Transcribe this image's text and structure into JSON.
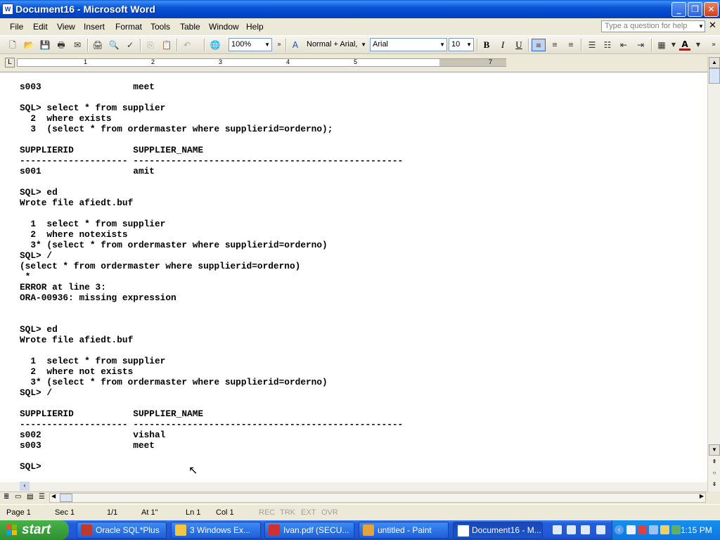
{
  "window": {
    "title": "Document16 - Microsoft Word",
    "app_icon": "W"
  },
  "menu": {
    "items": [
      "File",
      "Edit",
      "View",
      "Insert",
      "Format",
      "Tools",
      "Table",
      "Window",
      "Help"
    ],
    "help_placeholder": "Type a question for help"
  },
  "toolbar": {
    "zoom": "100%",
    "style": "Normal + Arial,",
    "font": "Arial",
    "size": "10",
    "bold": "B",
    "italic": "I",
    "underline": "U",
    "font_color_letter": "A"
  },
  "ruler": {
    "numbers": [
      "1",
      "2",
      "3",
      "4",
      "5",
      "7"
    ]
  },
  "document": {
    "lines": [
      "s003                 meet",
      "",
      "SQL> select * from supplier",
      "  2  where exists",
      "  3  (select * from ordermaster where supplierid=orderno);",
      "",
      "SUPPLIERID           SUPPLIER_NAME",
      "-------------------- --------------------------------------------------",
      "s001                 amit",
      "",
      "SQL> ed",
      "Wrote file afiedt.buf",
      "",
      "  1  select * from supplier",
      "  2  where notexists",
      "  3* (select * from ordermaster where supplierid=orderno)",
      "SQL> /",
      "(select * from ordermaster where supplierid=orderno)",
      " *",
      "ERROR at line 3:",
      "ORA-00936: missing expression",
      "",
      "",
      "SQL> ed",
      "Wrote file afiedt.buf",
      "",
      "  1  select * from supplier",
      "  2  where not exists",
      "  3* (select * from ordermaster where supplierid=orderno)",
      "SQL> /",
      "",
      "SUPPLIERID           SUPPLIER_NAME",
      "-------------------- --------------------------------------------------",
      "s002                 vishal",
      "s003                 meet",
      "",
      "SQL>"
    ]
  },
  "status": {
    "page": "Page  1",
    "sec": "Sec  1",
    "pages": "1/1",
    "at": "At  1\"",
    "ln": "Ln  1",
    "col": "Col  1",
    "rec": "REC",
    "trk": "TRK",
    "ext": "EXT",
    "ovr": "OVR"
  },
  "taskbar": {
    "start": "start",
    "tasks": [
      {
        "label": "Oracle SQL*Plus",
        "icon_color": "#c0392b"
      },
      {
        "label": "3 Windows Ex...",
        "icon_color": "#f4c542"
      },
      {
        "label": "Ivan.pdf (SECU...",
        "icon_color": "#d32f2f"
      },
      {
        "label": "untitled - Paint",
        "icon_color": "#e6a23c"
      },
      {
        "label": "Document16 - M...",
        "icon_color": "#1a5fd0"
      }
    ],
    "clock": "1:15 PM"
  }
}
